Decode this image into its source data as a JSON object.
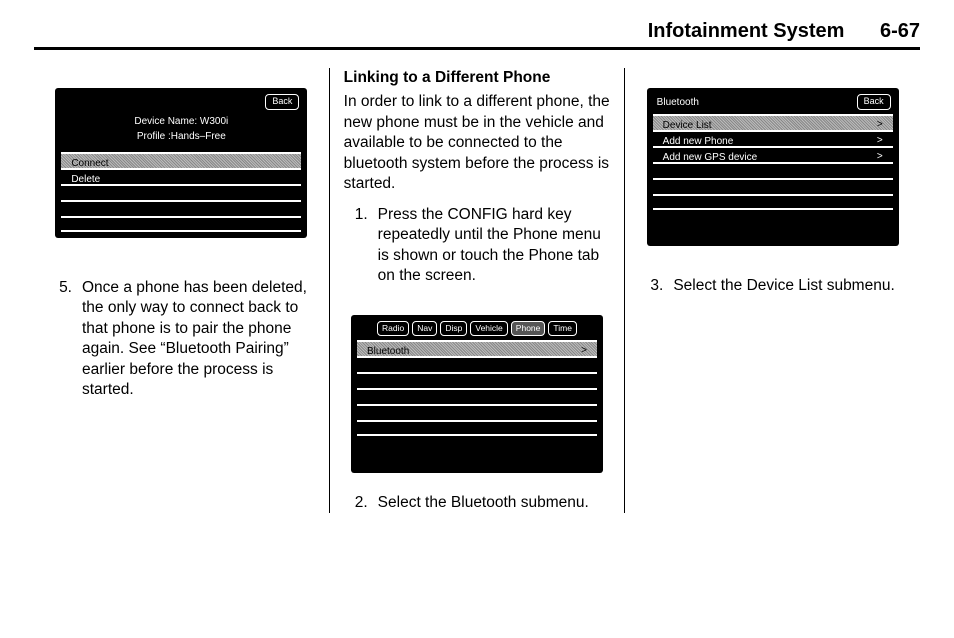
{
  "header": {
    "title": "Infotainment System",
    "page": "6-67"
  },
  "col1": {
    "screen": {
      "back": "Back",
      "device_label": "Device Name: W300i",
      "profile_label": "Profile :Hands–Free",
      "rows": [
        "Connect",
        "Delete",
        "",
        "",
        ""
      ]
    },
    "step5_num": "5.",
    "step5": "Once a phone has been deleted, the only way to connect back to that phone is to pair the phone again. See “Bluetooth Pairing” earlier before the process is started."
  },
  "col2": {
    "heading": "Linking to a Different Phone",
    "intro": "In order to link to a different phone, the new phone must be in the vehicle and available to be connected to the bluetooth system before the process is started.",
    "step1_num": "1.",
    "step1": "Press the CONFIG hard key repeatedly until the Phone menu is shown or touch the Phone tab on the screen.",
    "screen": {
      "tabs": [
        "Radio",
        "Nav",
        "Disp",
        "Vehicle",
        "Phone",
        "Time"
      ],
      "rows": [
        {
          "label": "Bluetooth",
          "sel": true,
          "chev": ">"
        },
        {
          "label": "",
          "sel": false
        },
        {
          "label": "",
          "sel": false
        },
        {
          "label": "",
          "sel": false
        },
        {
          "label": "",
          "sel": false
        },
        {
          "label": "",
          "sel": false
        }
      ]
    },
    "step2_num": "2.",
    "step2": "Select the Bluetooth submenu."
  },
  "col3": {
    "screen": {
      "title": "Bluetooth",
      "back": "Back",
      "rows": [
        {
          "label": "Device List",
          "sel": true,
          "chev": ">"
        },
        {
          "label": "Add new Phone",
          "sel": false,
          "chev": ">"
        },
        {
          "label": "Add new GPS device",
          "sel": false,
          "chev": ">"
        },
        {
          "label": "",
          "sel": false
        },
        {
          "label": "",
          "sel": false
        },
        {
          "label": "",
          "sel": false
        }
      ]
    },
    "step3_num": "3.",
    "step3": "Select the Device List submenu."
  }
}
